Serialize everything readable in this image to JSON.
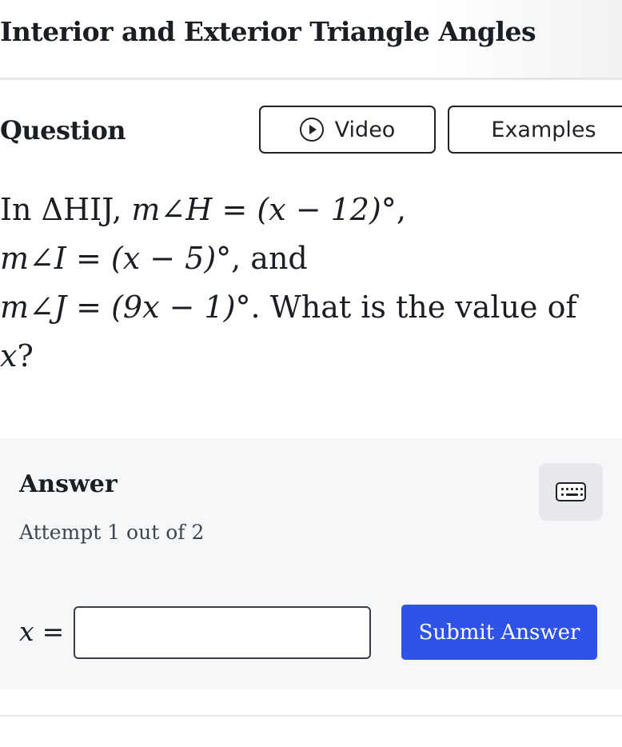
{
  "header": {
    "title": "Interior and Exterior Triangle Angles"
  },
  "question_section": {
    "label": "Question",
    "video_button": {
      "label": "Video",
      "icon": "play-circle-icon"
    },
    "examples_button": {
      "label": "Examples"
    }
  },
  "question": {
    "intro": "In ",
    "triangle": "ΔHIJ",
    "line1_sep": ", ",
    "angle_h": "m∠H = (x − 12)°",
    "comma1": ",",
    "angle_i": "m∠I = (x − 5)°",
    "and": ", and",
    "angle_j": "m∠J = (9x − 1)°",
    "ask": ". What is the value of",
    "variable": "x",
    "qmark": "?"
  },
  "answer": {
    "title": "Answer",
    "keyboard_icon": "keyboard-icon",
    "attempt_text": "Attempt 1 out of 2",
    "input_label_var": "x",
    "input_label_eq": "=",
    "input_value": "",
    "input_placeholder": "",
    "submit_label": "Submit Answer"
  },
  "colors": {
    "submit_bg": "#2f52e8",
    "answer_panel_bg": "#f6f7f9",
    "text": "#1b1f24"
  }
}
